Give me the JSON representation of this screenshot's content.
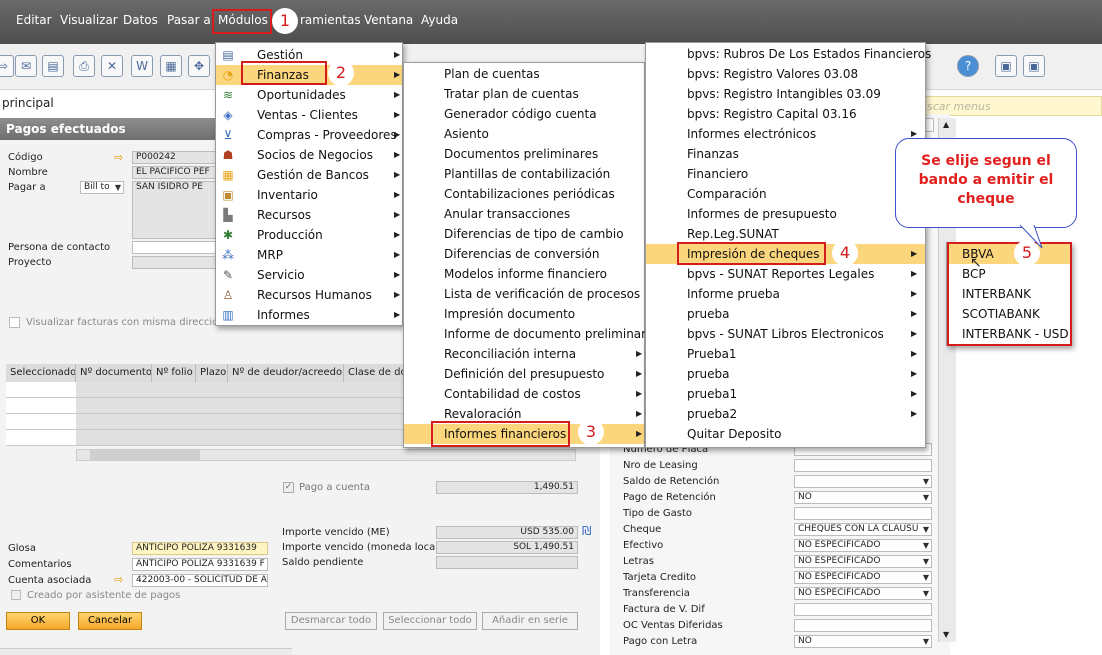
{
  "menubar": {
    "items": [
      "Editar",
      "Visualizar",
      "Datos",
      "Pasar a",
      "Módulos",
      "ramientas",
      "Ventana",
      "Ayuda"
    ]
  },
  "breadcrumb": "principal",
  "search_placeholder": "scar menus",
  "window_title": "Pagos efectuados",
  "form": {
    "codigo_label": "Código",
    "codigo_value": "P000242",
    "nombre_label": "Nombre",
    "nombre_value": "EL PACIFICO PEF",
    "pagar_a_label": "Pagar a",
    "pagar_a_select": "Bill to",
    "pagar_a_value": "SAN ISIDRO  PE",
    "contacto_label": "Persona de contacto",
    "proyecto_label": "Proyecto",
    "visualizar_checkbox": "Visualizar facturas con misma dirección fac",
    "pago_a_cuenta_label": "Pago a cuenta",
    "pago_a_cuenta_value": "1,490.51",
    "importe_me_label": "Importe vencido (ME)",
    "importe_me_value": "USD 535.00",
    "importe_local_label": "Importe vencido (moneda local)",
    "importe_local_value": "SOL 1,490.51",
    "saldo_label": "Saldo pendiente",
    "glosa_label": "Glosa",
    "glosa_value": "ANTICIPO POLIZA 9331639",
    "comentarios_label": "Comentarios",
    "comentarios_value": "ANTICIPO POLIZA 9331639 F",
    "cuenta_label": "Cuenta asociada",
    "cuenta_value": "422003-00 - SOLICITUD DE A",
    "creado_label": "Creado por asistente de pagos",
    "ok": "OK",
    "cancelar": "Cancelar",
    "desmarcar": "Desmarcar todo",
    "seleccionar": "Seleccionar todo",
    "anadir": "Añadir en serie"
  },
  "grid_headers": [
    "Seleccionado",
    "Nº documento",
    "Nº folio",
    "Plazo",
    "Nº de deudor/acreedor",
    "Clase de do"
  ],
  "right_panel": [
    {
      "label": "Numero de Placa",
      "value": "",
      "dropdown": false
    },
    {
      "label": "Nro de Leasing",
      "value": "",
      "dropdown": false
    },
    {
      "label": "Saldo de Retención",
      "value": "",
      "dropdown": true
    },
    {
      "label": "Pago de Retención",
      "value": "NO",
      "dropdown": true
    },
    {
      "label": "Tipo de Gasto",
      "value": "",
      "dropdown": false
    },
    {
      "label": "Cheque",
      "value": "CHEQUES CON LA CLAUSU",
      "dropdown": true
    },
    {
      "label": "Efectivo",
      "value": "NO ESPECIFICADO",
      "dropdown": true
    },
    {
      "label": "Letras",
      "value": "NO ESPECIFICADO",
      "dropdown": true
    },
    {
      "label": "Tarjeta Credito",
      "value": "NO ESPECIFICADO",
      "dropdown": true
    },
    {
      "label": "Transferencia",
      "value": "NO ESPECIFICADO",
      "dropdown": true
    },
    {
      "label": "Factura de V. Dif",
      "value": "",
      "dropdown": false
    },
    {
      "label": "OC Ventas Diferidas",
      "value": "",
      "dropdown": false
    },
    {
      "label": "Pago con Letra",
      "value": "NO",
      "dropdown": true
    }
  ],
  "menu_modulos": [
    {
      "label": "Gestión",
      "icon": "ledger-icon"
    },
    {
      "label": "Finanzas",
      "icon": "pie-chart-icon"
    },
    {
      "label": "Oportunidades",
      "icon": "trend-icon"
    },
    {
      "label": "Ventas - Clientes",
      "icon": "tag-icon"
    },
    {
      "label": "Compras - Proveedores",
      "icon": "cart-icon"
    },
    {
      "label": "Socios de Negocios",
      "icon": "people-icon"
    },
    {
      "label": "Gestión de Bancos",
      "icon": "bank-icon"
    },
    {
      "label": "Inventario",
      "icon": "box-icon"
    },
    {
      "label": "Recursos",
      "icon": "factory-icon"
    },
    {
      "label": "Producción",
      "icon": "gear-icon"
    },
    {
      "label": "MRP",
      "icon": "mrp-icon"
    },
    {
      "label": "Servicio",
      "icon": "wrench-icon"
    },
    {
      "label": "Recursos Humanos",
      "icon": "person-icon"
    },
    {
      "label": "Informes",
      "icon": "report-icon"
    }
  ],
  "menu_finanzas": [
    {
      "label": "Plan de cuentas",
      "sub": false
    },
    {
      "label": "Tratar plan de cuentas",
      "sub": false
    },
    {
      "label": "Generador código cuenta",
      "sub": false
    },
    {
      "label": "Asiento",
      "sub": false
    },
    {
      "label": "Documentos preliminares",
      "sub": false
    },
    {
      "label": "Plantillas de contabilización",
      "sub": false
    },
    {
      "label": "Contabilizaciones periódicas",
      "sub": false
    },
    {
      "label": "Anular transacciones",
      "sub": false
    },
    {
      "label": "Diferencias de tipo de cambio",
      "sub": false
    },
    {
      "label": "Diferencias de conversión",
      "sub": false
    },
    {
      "label": "Modelos informe financiero",
      "sub": false
    },
    {
      "label": "Lista de verificación de procesos",
      "sub": false
    },
    {
      "label": "Impresión documento",
      "sub": false
    },
    {
      "label": "Informe de documento preliminar",
      "sub": false
    },
    {
      "label": "Reconciliación interna",
      "sub": true
    },
    {
      "label": "Definición del presupuesto",
      "sub": true
    },
    {
      "label": "Contabilidad de costos",
      "sub": true
    },
    {
      "label": "Revaloración",
      "sub": true
    },
    {
      "label": "Informes financieros",
      "sub": true
    }
  ],
  "menu_informes": [
    {
      "label": "bpvs: Rubros De Los Estados Financieros",
      "sub": false
    },
    {
      "label": "bpvs: Registro Valores 03.08",
      "sub": false
    },
    {
      "label": "bpvs: Registro Intangibles 03.09",
      "sub": false
    },
    {
      "label": "bpvs: Registro Capital 03.16",
      "sub": false
    },
    {
      "label": "Informes electrónicos",
      "sub": true
    },
    {
      "label": "Finanzas",
      "sub": false
    },
    {
      "label": "Financiero",
      "sub": false
    },
    {
      "label": "Comparación",
      "sub": false
    },
    {
      "label": "Informes de presupuesto",
      "sub": false
    },
    {
      "label": "Rep.Leg.SUNAT",
      "sub": false
    },
    {
      "label": "Impresión de cheques",
      "sub": true
    },
    {
      "label": "bpvs - SUNAT Reportes Legales",
      "sub": true
    },
    {
      "label": "Informe prueba",
      "sub": true
    },
    {
      "label": "prueba",
      "sub": true
    },
    {
      "label": "bpvs - SUNAT Libros Electronicos",
      "sub": true
    },
    {
      "label": "Prueba1",
      "sub": true
    },
    {
      "label": "prueba",
      "sub": true
    },
    {
      "label": "prueba1",
      "sub": true
    },
    {
      "label": "prueba2",
      "sub": true
    },
    {
      "label": "Quitar Deposito",
      "sub": false
    }
  ],
  "menu_bancos": [
    "BBVA",
    "BCP",
    "INTERBANK",
    "SCOTIABANK",
    "INTERBANK - USD"
  ],
  "steps": [
    "1",
    "2",
    "3",
    "4",
    "5"
  ],
  "callout": "Se elije segun el bando a emitir el cheque"
}
